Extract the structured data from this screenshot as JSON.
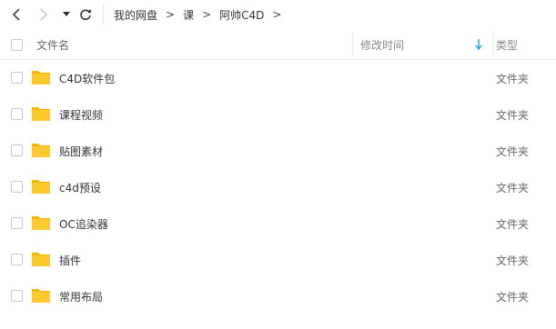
{
  "toolbar": {
    "back_icon": "chevron-left-icon",
    "forward_icon": "chevron-right-icon",
    "dropdown_icon": "caret-down-icon",
    "refresh_icon": "refresh-icon"
  },
  "breadcrumb": {
    "items": [
      "我的网盘",
      "课",
      "阿帅C4D"
    ],
    "separator": ">"
  },
  "header": {
    "name": "文件名",
    "mtime": "修改时间",
    "type": "类型",
    "sort_icon": "sort-down-icon",
    "sort_color": "#1e9bf0"
  },
  "rows": [
    {
      "name": "C4D软件包",
      "type": "文件夹"
    },
    {
      "name": "课程视频",
      "type": "文件夹"
    },
    {
      "name": "贴图素材",
      "type": "文件夹"
    },
    {
      "name": "c4d预设",
      "type": "文件夹"
    },
    {
      "name": "OC追染器",
      "type": "文件夹"
    },
    {
      "name": "插件",
      "type": "文件夹"
    },
    {
      "name": "常用布局",
      "type": "文件夹"
    }
  ],
  "colors": {
    "folder": "#ffc92e",
    "folder_tab": "#f5b400"
  }
}
